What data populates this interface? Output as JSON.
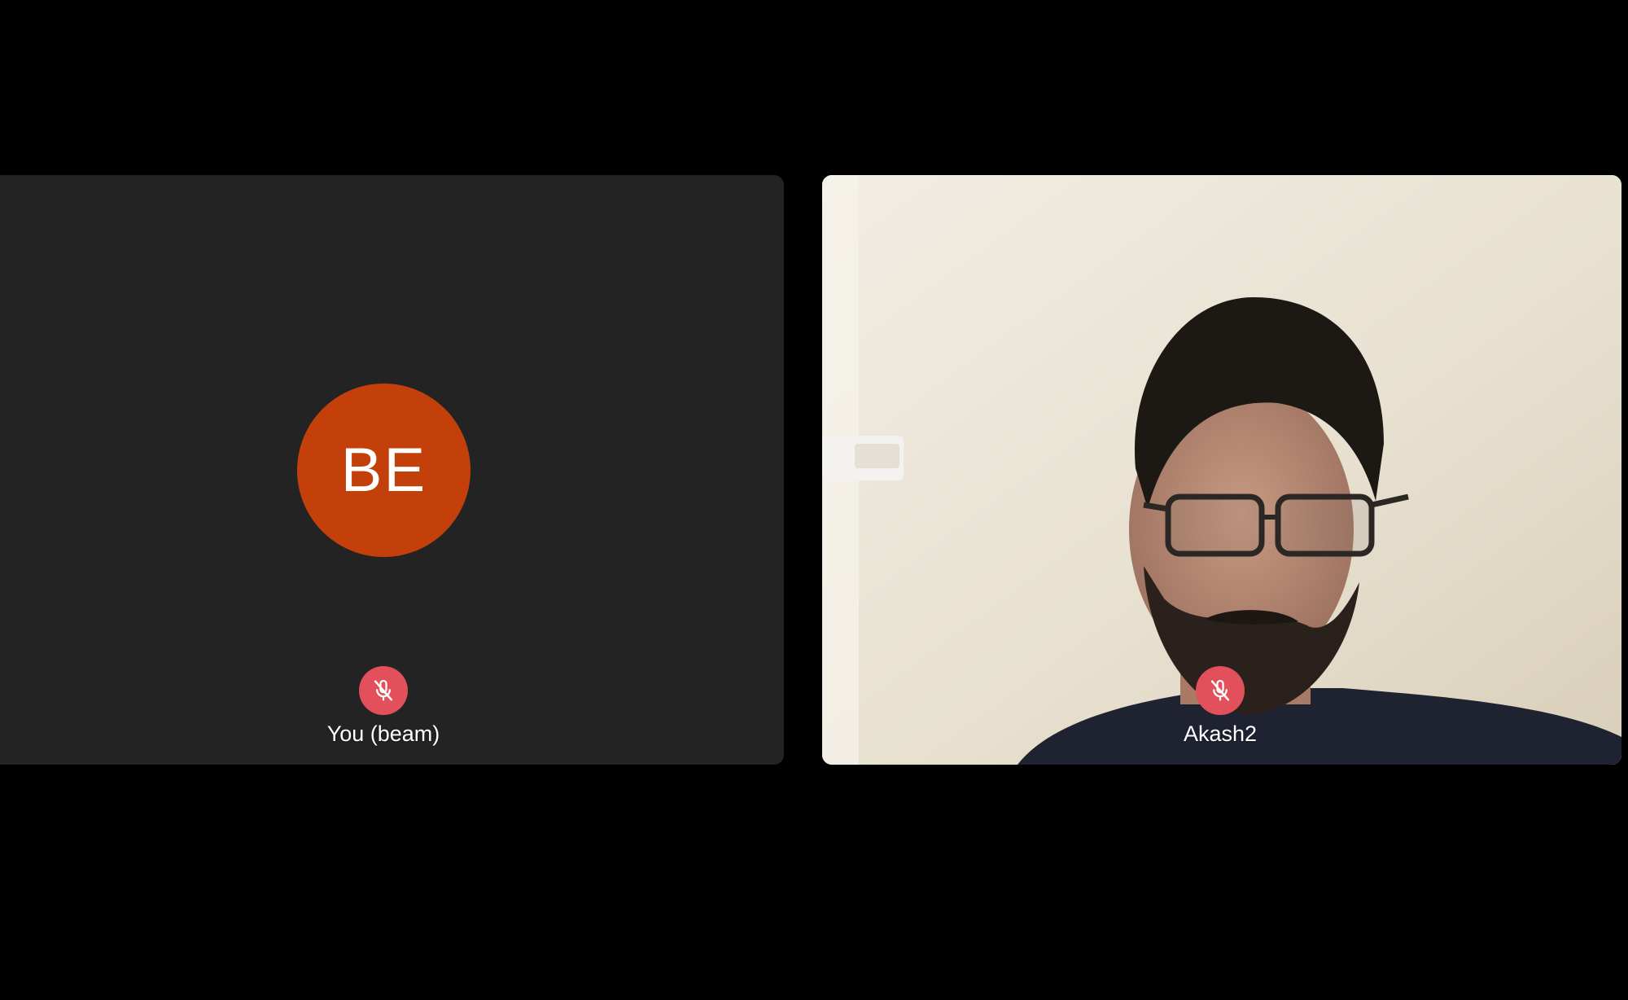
{
  "participants": [
    {
      "initials": "BE",
      "label": "You (beam)",
      "avatar_color": "#c4400b",
      "video_on": false,
      "muted": true,
      "mute_icon": "mic-off-icon"
    },
    {
      "label": "Akash2",
      "video_on": true,
      "muted": true,
      "mute_icon": "mic-off-icon"
    }
  ],
  "colors": {
    "background": "#000000",
    "tile_bg": "#232323",
    "mute_badge": "#e2505c",
    "label_text": "#ffffff"
  }
}
